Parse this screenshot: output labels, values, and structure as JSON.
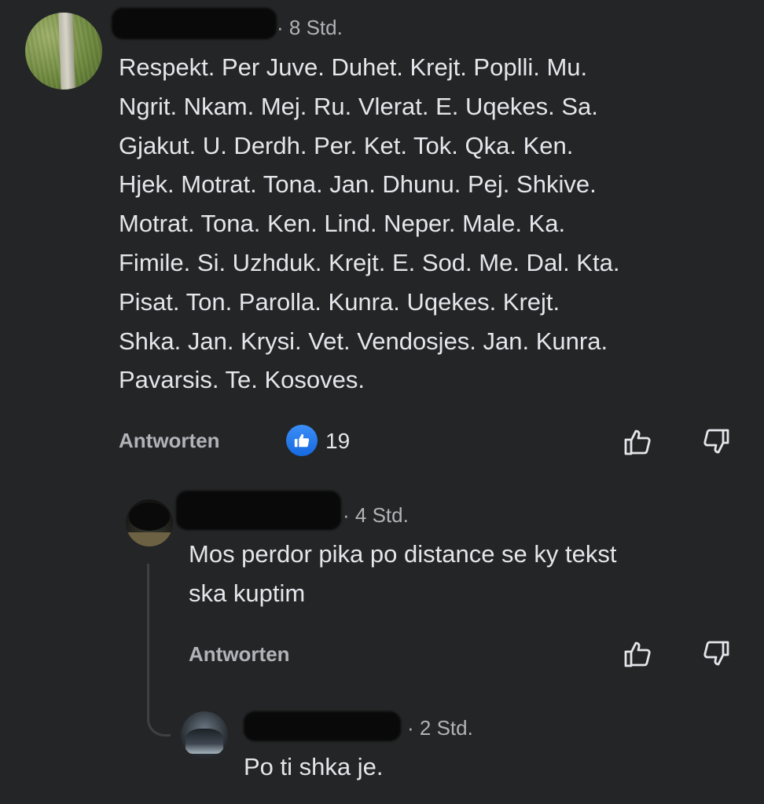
{
  "comment_main": {
    "time": "· 8 Std.",
    "text": "Respekt. Per Juve.   Duhet. Krejt. Poplli. Mu.\nNgrit. Nkam. Mej. Ru. Vlerat. E. Uqekes. Sa.\nGjakut. U. Derdh. Per. Ket. Tok.   Qka. Ken.\nHjek. Motrat. Tona. Jan. Dhunu. Pej. Shkive.\nMotrat. Tona. Ken. Lind. Neper. Male. Ka.\nFimile. Si. Uzhduk. Krejt. E. Sod. Me. Dal. Kta.\nPisat. Ton. Parolla. Kunra. Uqekes.   Krejt.\nShka. Jan. Krysi. Vet. Vendosjes. Jan. Kunra.\nPavarsis. Te. Kosoves.",
    "reply_label": "Antworten",
    "like_count": "19"
  },
  "reply_1": {
    "time": "· 4 Std.",
    "text": "Mos perdor pika po distance se ky tekst\nska kuptim",
    "reply_label": "Antworten"
  },
  "reply_2": {
    "time": "· 2 Std.",
    "text": "Po ti shka je."
  },
  "icons": {
    "like": "thumbs-up-outline",
    "dislike": "thumbs-down-outline",
    "reaction": "like-reaction"
  },
  "colors": {
    "background": "#242526",
    "text": "#e4e6eb",
    "secondary_text": "#b0b3b8",
    "like_blue": "#1877f2"
  }
}
